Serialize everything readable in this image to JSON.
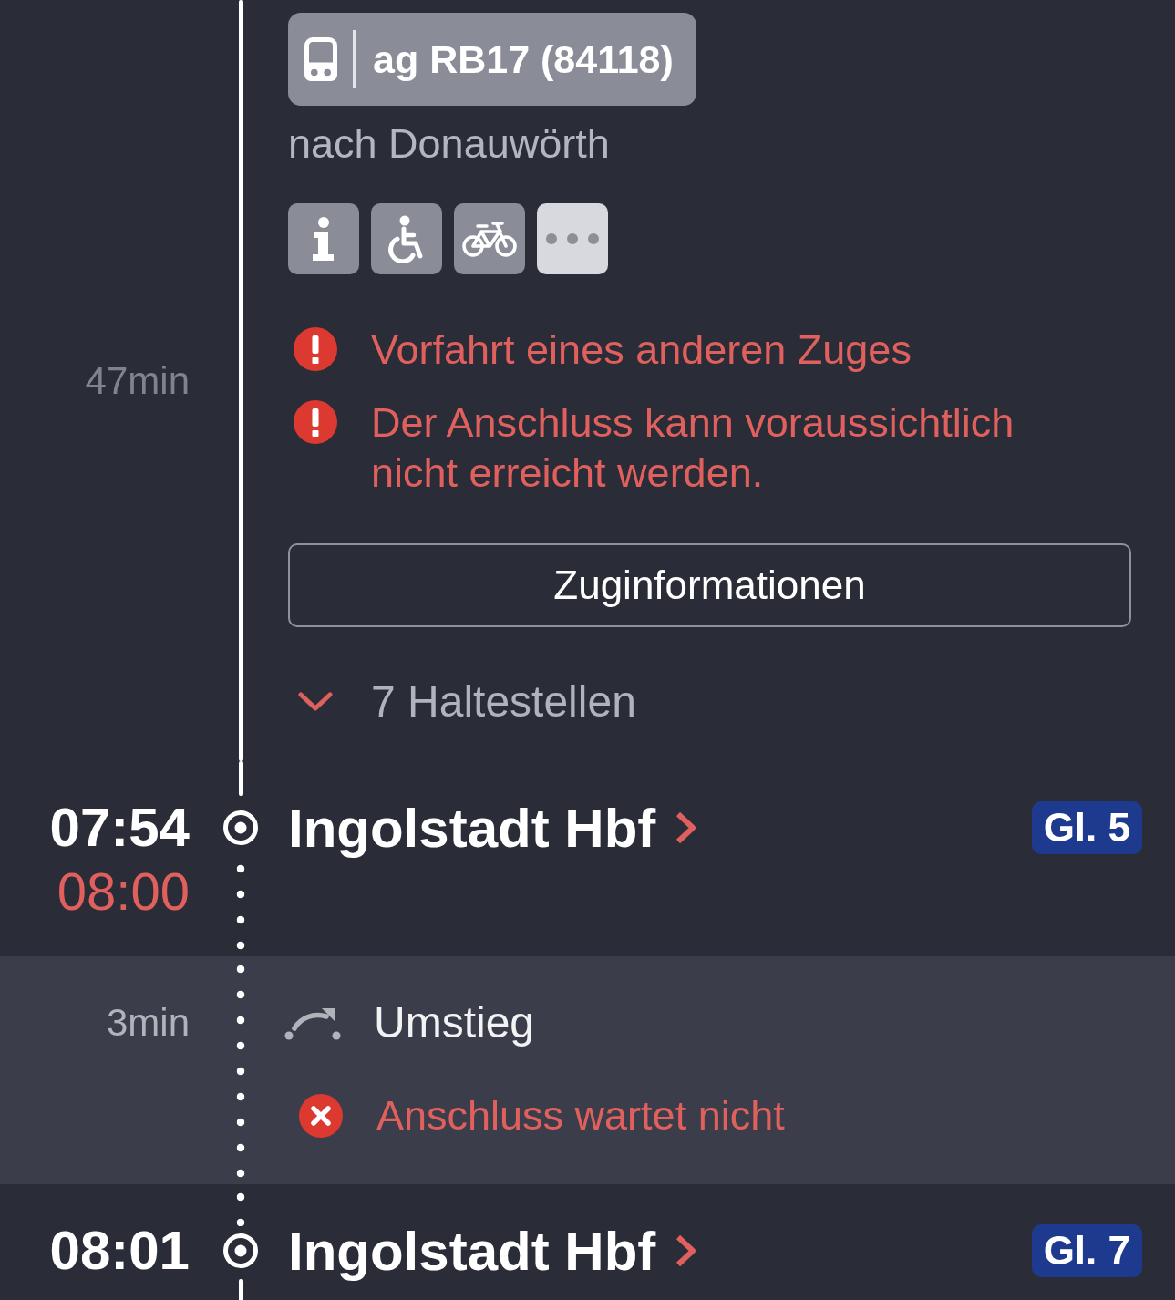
{
  "journey": [
    {
      "kind": "leg",
      "duration": "47min",
      "train": "ag RB17 (84118)",
      "direction": "nach Donauwörth",
      "alerts": [
        "Vorfahrt eines anderen Zuges",
        "Der Anschluss kann voraussichtlich nicht erreicht werden."
      ],
      "details_button": "Zuginformationen",
      "stops_toggle": {
        "label": "7 Haltestellen",
        "expanded": false
      }
    },
    {
      "kind": "stop",
      "time": "07:54",
      "realtime": "08:00",
      "delayed": true,
      "station": "Ingolstadt Hbf",
      "platform": "Gl. 5"
    },
    {
      "kind": "transfer",
      "duration": "3min",
      "label": "Umstieg",
      "alert": "Anschluss wartet nicht"
    },
    {
      "kind": "stop",
      "time": "08:01",
      "station": "Ingolstadt Hbf",
      "platform": "Gl. 7"
    }
  ]
}
